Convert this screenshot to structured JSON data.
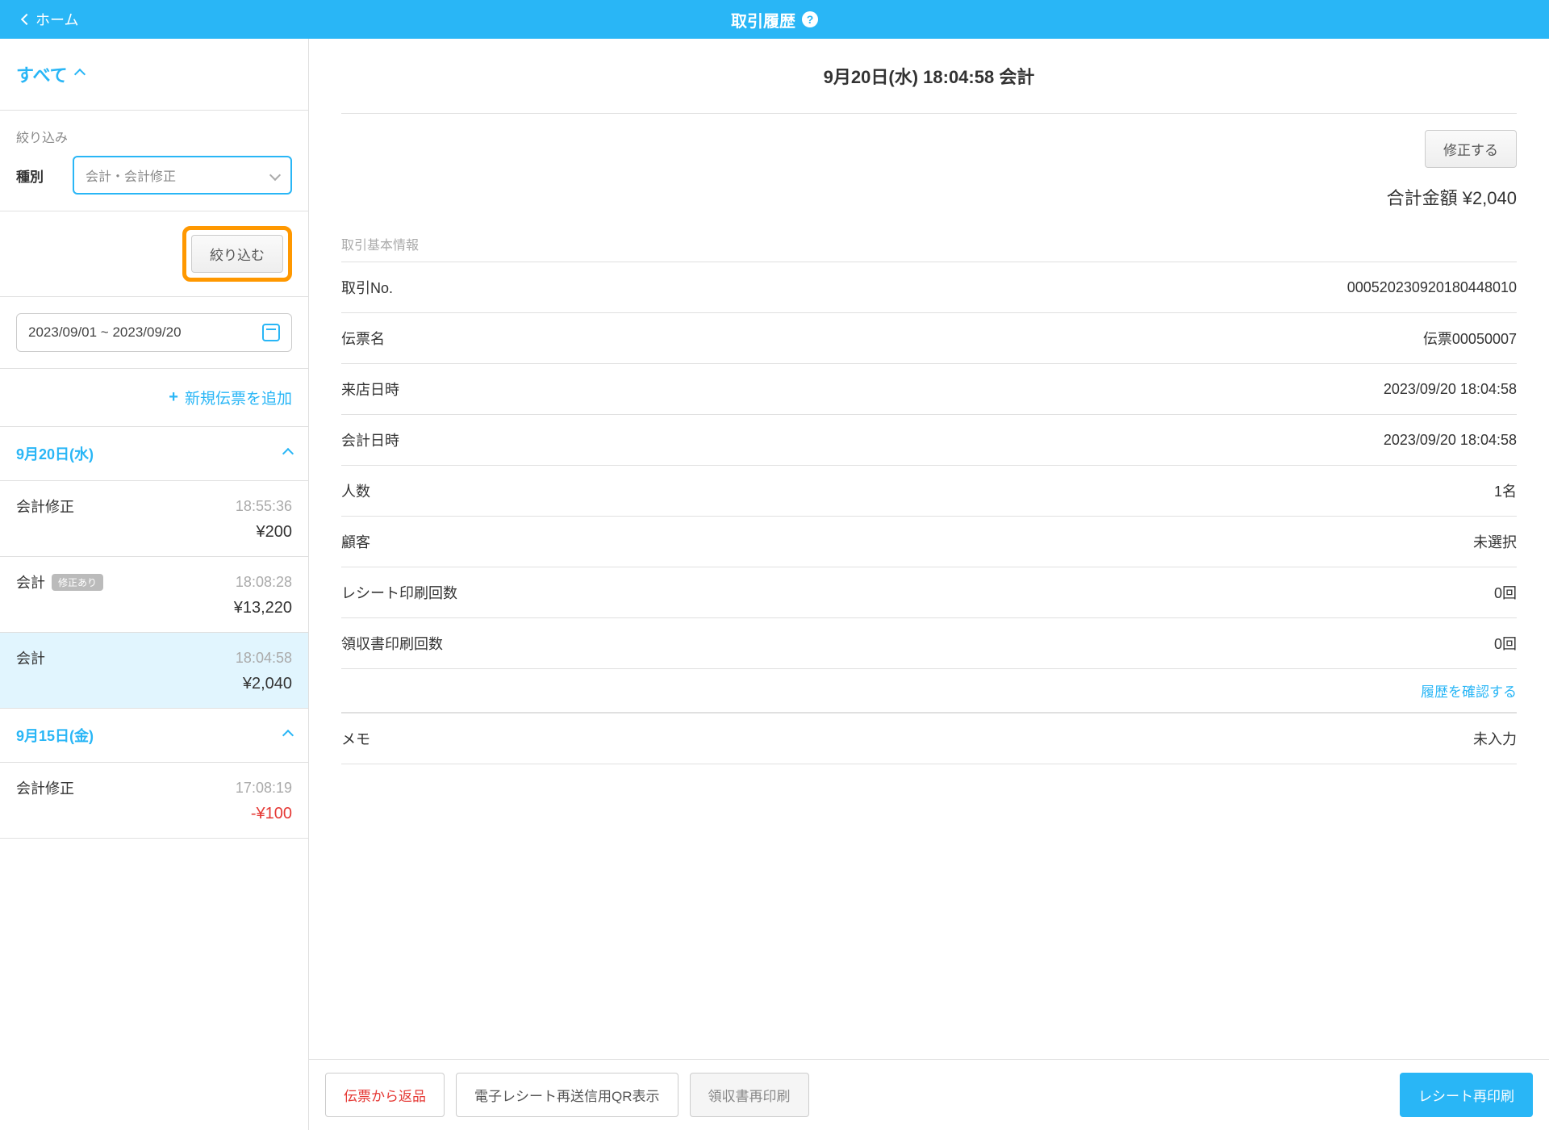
{
  "header": {
    "back": "ホーム",
    "title": "取引履歴"
  },
  "sidebar": {
    "all": "すべて",
    "filterLabel": "絞り込み",
    "typeLabel": "種別",
    "typeValue": "会計・会計修正",
    "filterBtn": "絞り込む",
    "dateRange": "2023/09/01 ~ 2023/09/20",
    "addLabel": "新規伝票を追加",
    "groups": [
      {
        "date": "9月20日(水)",
        "items": [
          {
            "title": "会計修正",
            "badge": "",
            "time": "18:55:36",
            "amount": "¥200",
            "neg": false,
            "selected": false
          },
          {
            "title": "会計",
            "badge": "修正あり",
            "time": "18:08:28",
            "amount": "¥13,220",
            "neg": false,
            "selected": false
          },
          {
            "title": "会計",
            "badge": "",
            "time": "18:04:58",
            "amount": "¥2,040",
            "neg": false,
            "selected": true
          }
        ]
      },
      {
        "date": "9月15日(金)",
        "items": [
          {
            "title": "会計修正",
            "badge": "",
            "time": "17:08:19",
            "amount": "-¥100",
            "neg": true,
            "selected": false
          }
        ]
      }
    ]
  },
  "detail": {
    "title": "9月20日(水) 18:04:58 会計",
    "editBtn": "修正する",
    "totalLabel": "合計金額",
    "totalValue": "¥2,040",
    "sectionLabel": "取引基本情報",
    "rows": [
      {
        "label": "取引No.",
        "value": "000520230920180448010"
      },
      {
        "label": "伝票名",
        "value": "伝票00050007"
      },
      {
        "label": "来店日時",
        "value": "2023/09/20 18:04:58"
      },
      {
        "label": "会計日時",
        "value": "2023/09/20 18:04:58"
      },
      {
        "label": "人数",
        "value": "1名"
      },
      {
        "label": "顧客",
        "value": "未選択"
      },
      {
        "label": "レシート印刷回数",
        "value": "0回"
      },
      {
        "label": "領収書印刷回数",
        "value": "0回"
      }
    ],
    "historyLink": "履歴を確認する",
    "memoLabel": "メモ",
    "memoValue": "未入力"
  },
  "footer": {
    "returnBtn": "伝票から返品",
    "qrBtn": "電子レシート再送信用QR表示",
    "receiptBtn": "領収書再印刷",
    "reprintBtn": "レシート再印刷"
  }
}
